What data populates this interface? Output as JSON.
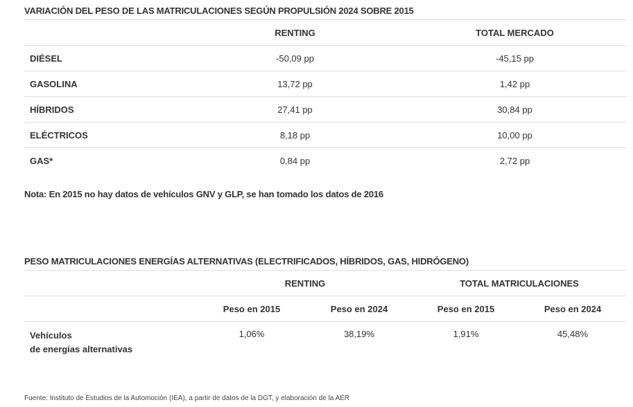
{
  "table1": {
    "title": "VARIACIÓN DEL PESO DE LAS MATRICULACIONES SEGÚN PROPULSIÓN 2024 SOBRE 2015",
    "headers": [
      "",
      "RENTING",
      "TOTAL MERCADO"
    ],
    "rows": [
      {
        "label": "DIÉSEL",
        "renting": "-50,09 pp",
        "total": "-45,15 pp"
      },
      {
        "label": "GASOLINA",
        "renting": "13,72 pp",
        "total": "1,42 pp"
      },
      {
        "label": "HÍBRIDOS",
        "renting": "27,41 pp",
        "total": "30,84 pp"
      },
      {
        "label": "ELÉCTRICOS",
        "renting": "8,18 pp",
        "total": "10,00 pp"
      },
      {
        "label": "GAS*",
        "renting": "0,84 pp",
        "total": "2,72 pp"
      }
    ],
    "note": "Nota: En 2015 no hay datos de vehículos GNV y GLP, se han tomado los datos de 2016"
  },
  "table2": {
    "title": "PESO MATRICULACIONES ENERGÍAS ALTERNATIVAS (ELECTRIFICADOS, HÍBRIDOS, GAS, HIDRÓGENO)",
    "group_headers": [
      "RENTING",
      "TOTAL MATRICULACIONES"
    ],
    "sub_headers": [
      "Peso en 2015",
      "Peso en 2024",
      "Peso en 2015",
      "Peso en 2024"
    ],
    "row": {
      "label_line1": "Vehículos",
      "label_line2": "de energías alternativas",
      "values": [
        "1,06%",
        "38,19%",
        "1,91%",
        "45,48%"
      ]
    }
  },
  "source": "Fuente: Instituto de Estudios de la Automoción (IEA), a partir de datos de la DGT, y elaboración de la AER"
}
